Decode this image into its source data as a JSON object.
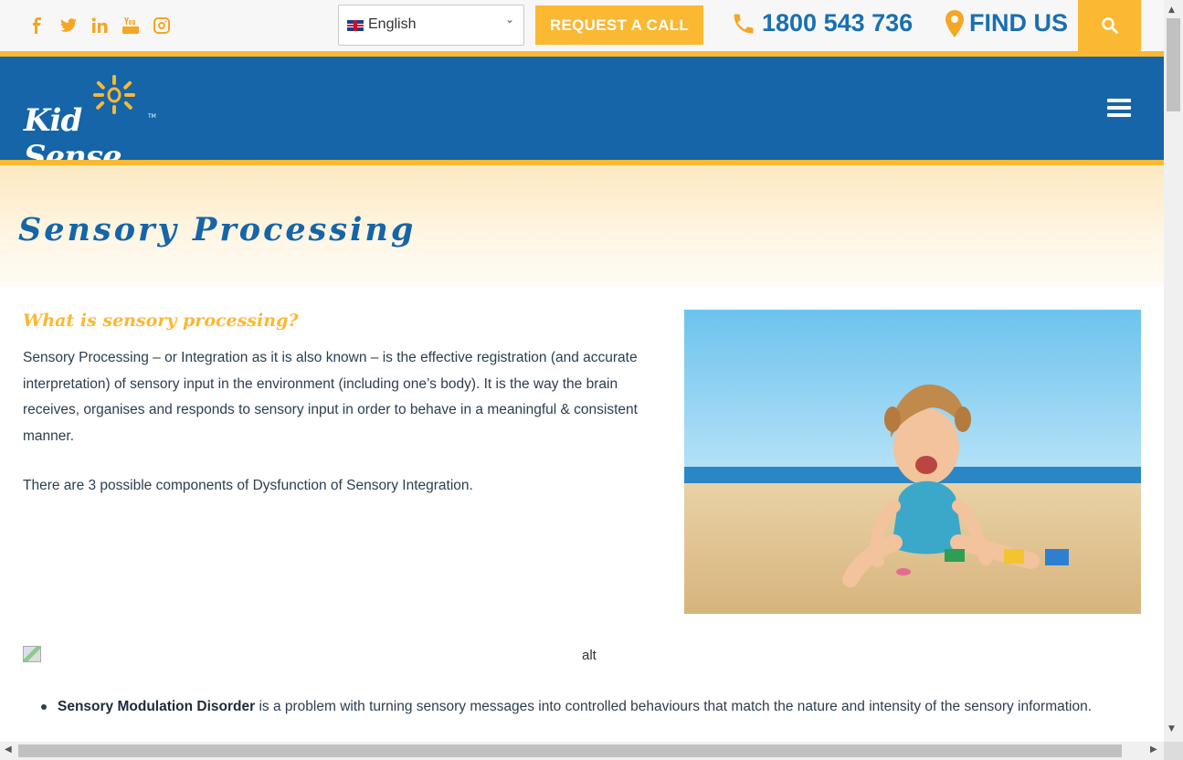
{
  "topbar": {
    "social": [
      {
        "icon": "facebook-icon",
        "glyph": "f"
      },
      {
        "icon": "twitter-icon",
        "glyph": ""
      },
      {
        "icon": "linkedin-icon",
        "glyph": "in"
      },
      {
        "icon": "youtube-icon",
        "glyph": ""
      },
      {
        "icon": "instagram-icon",
        "glyph": ""
      }
    ],
    "language": "English",
    "request_call": "REQUEST A CALL",
    "phone": "1800 543 736",
    "find_us": "FIND US"
  },
  "header": {
    "logo_text": "Kid Sense",
    "logo_tm": "TM"
  },
  "hero": {
    "title": "Sensory Processing"
  },
  "content": {
    "heading": "What is sensory processing?",
    "paragraph1": "Sensory Processing – or Integration as it is also known – is the effective registration (and accurate interpretation) of sensory input in the environment (including one’s body). It is the way the brain receives, organises and responds to sensory input in order to behave in a meaningful & consistent manner.",
    "paragraph2": "There are 3 possible components of Dysfunction of Sensory Integration.",
    "image_alt": "alt",
    "list": [
      {
        "bold": "Sensory Modulation Disorder",
        "text": " is a problem with turning sensory messages into controlled behaviours that match the nature and intensity of the sensory information."
      }
    ]
  },
  "colors": {
    "accent": "#fbb832",
    "brand_blue": "#1565a8",
    "text": "#2c3e50"
  }
}
